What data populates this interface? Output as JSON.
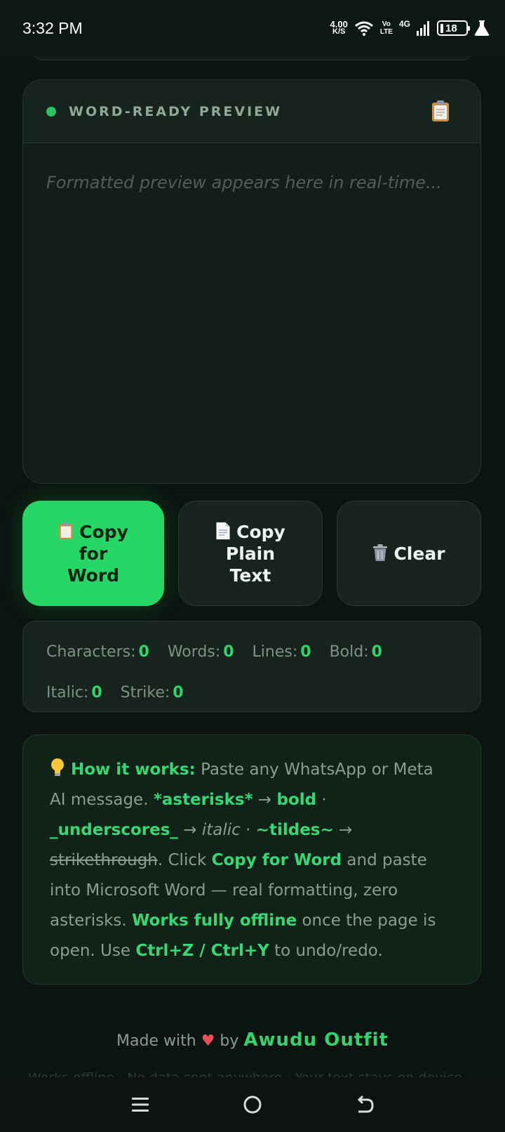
{
  "status_bar": {
    "time": "3:32 PM",
    "net_speed_value": "4.00",
    "net_speed_unit": "K/S",
    "volte_top": "Vo",
    "volte_bottom": "LTE",
    "network": "4G",
    "battery": "18",
    "icons": [
      "wifi-icon",
      "signal-icon",
      "battery-icon",
      "lab-icon"
    ]
  },
  "preview": {
    "title": "WORD-READY PREVIEW",
    "placeholder": "Formatted preview appears here in real-time...",
    "icon": "clipboard-icon"
  },
  "buttons": {
    "copy_word_l1": "Copy",
    "copy_word_l2": "for",
    "copy_word_l3": "Word",
    "copy_plain_l1": "Copy",
    "copy_plain_l2": "Plain",
    "copy_plain_l3": "Text",
    "clear": "Clear"
  },
  "stats": {
    "characters_label": "Characters:",
    "characters": "0",
    "words_label": "Words:",
    "words": "0",
    "lines_label": "Lines:",
    "lines": "0",
    "bold_label": "Bold:",
    "bold": "0",
    "italic_label": "Italic:",
    "italic": "0",
    "strike_label": "Strike:",
    "strike": "0"
  },
  "info": {
    "heading": "How it works:",
    "t1": " Paste any WhatsApp or Meta AI message. ",
    "asterisks": "*asterisks*",
    "arrow1": " → ",
    "bold_word": "bold",
    "sep1": " · ",
    "underscores": "_underscores_",
    "arrow2": " → ",
    "italic_word": "italic",
    "sep2": " · ",
    "tildes": "~tildes~",
    "arrow3": " → ",
    "strike_word": "strikethrough",
    "t2": ". Click ",
    "copy_for_word": "Copy for Word",
    "t3": " and paste into Microsoft Word — real formatting, zero asterisks. ",
    "offline": "Works fully offline",
    "t4": " once the page is open. Use ",
    "shortcuts": "Ctrl+Z / Ctrl+Y",
    "t5": " to undo/redo."
  },
  "footer": {
    "made_with": "Made with",
    "by": "by",
    "brand": "Awudu Outfit",
    "sub": "Works offline · No data sent anywhere · Your text stays on device"
  }
}
